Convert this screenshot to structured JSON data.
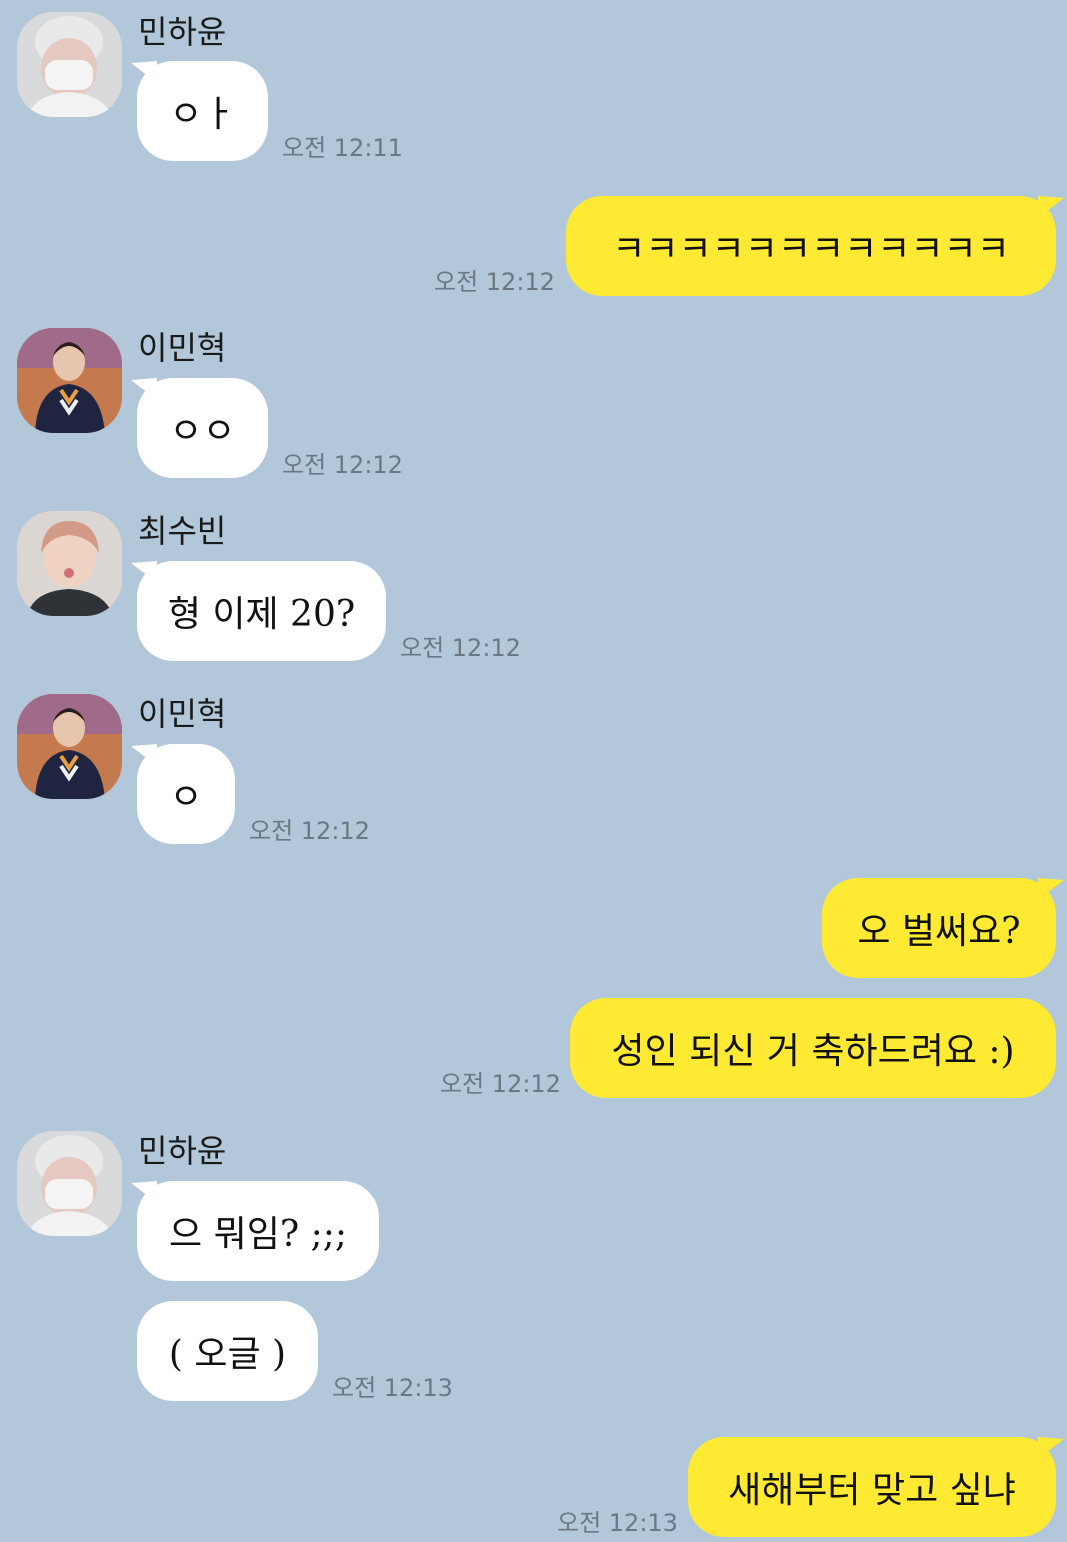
{
  "messages": [
    {
      "sender": "민하윤",
      "text": "ㅇㅏ",
      "time": "오전 12:11"
    },
    {
      "sender": "me",
      "text": "ㅋㅋㅋㅋㅋㅋㅋㅋㅋㅋㅋㅋ",
      "time": "오전 12:12"
    },
    {
      "sender": "이민혁",
      "text": "ㅇㅇ",
      "time": "오전 12:12"
    },
    {
      "sender": "최수빈",
      "text": "형 이제 20?",
      "time": "오전 12:12"
    },
    {
      "sender": "이민혁",
      "text": "ㅇ",
      "time": "오전 12:12"
    },
    {
      "sender": "me",
      "text": "오 벌써요?"
    },
    {
      "sender": "me",
      "text": "성인 되신 거 축하드려요 :)",
      "time": "오전 12:12"
    },
    {
      "sender": "민하윤",
      "text": "으 뭐임? ;;;"
    },
    {
      "sender": "민하윤",
      "text": "( 오글 )",
      "time": "오전 12:13"
    },
    {
      "sender": "me",
      "text": "새해부터 맞고 싶냐",
      "time": "오전 12:13"
    }
  ],
  "colors": {
    "background": "#b2c7d9",
    "incoming_bubble": "#ffffff",
    "outgoing_bubble": "#fee933",
    "timestamp": "#6b7883"
  },
  "icons": {
    "avatar_minhayoon": "masked-person-avatar",
    "avatar_leeminhyuk": "person-in-sweater-avatar",
    "avatar_choisubin": "person-pink-hair-avatar"
  }
}
